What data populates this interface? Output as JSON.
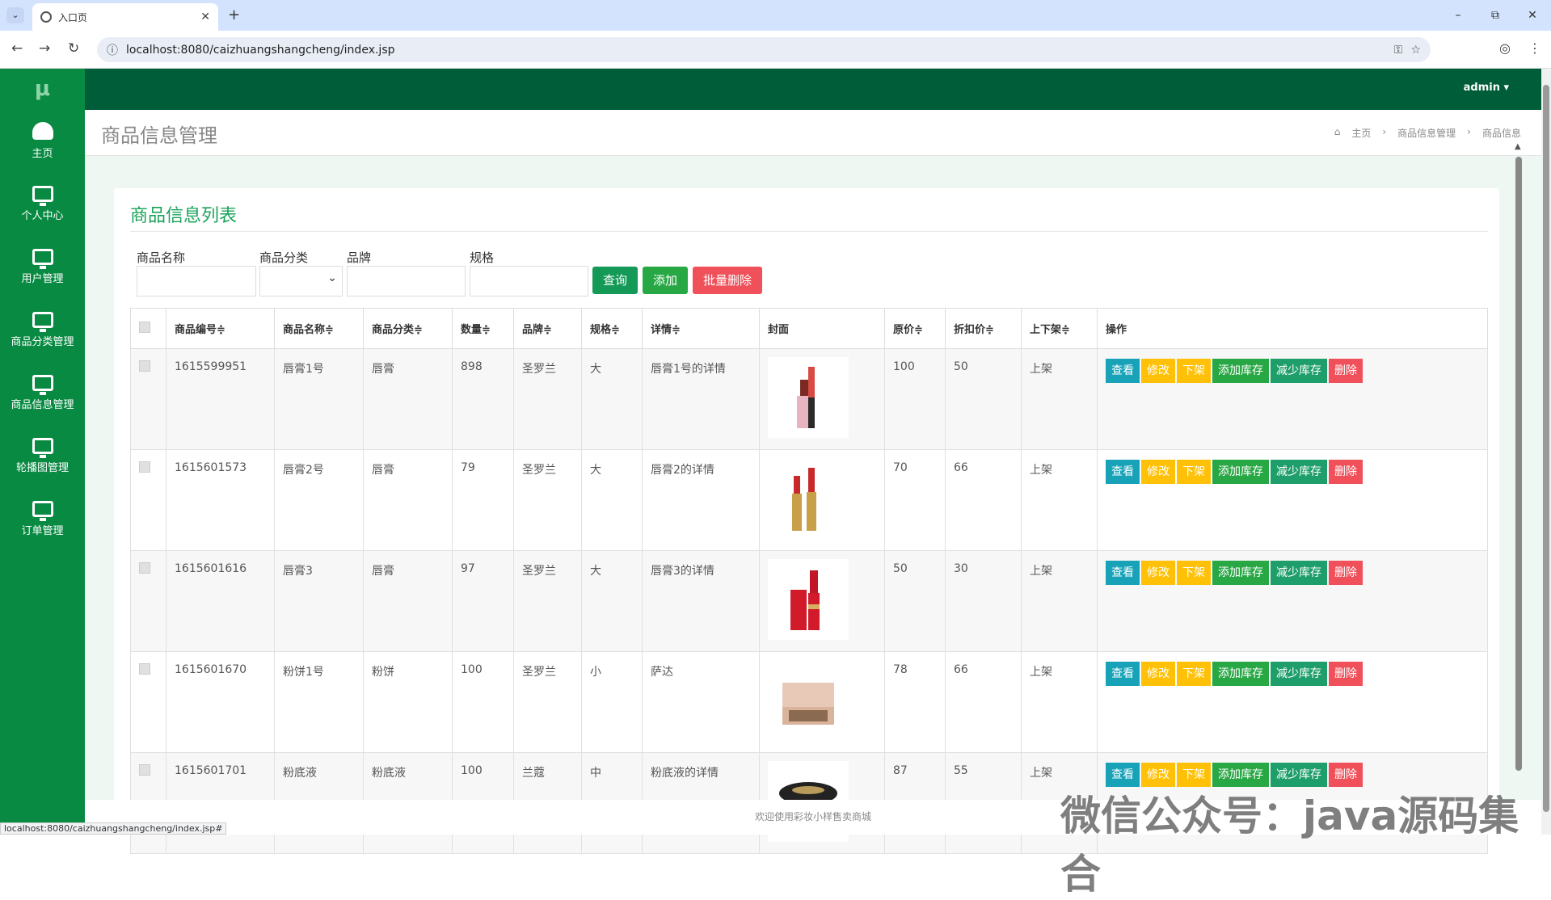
{
  "browser": {
    "tab_title": "入口页",
    "url": "localhost:8080/caizhuangshangcheng/index.jsp",
    "status_url": "localhost:8080/caizhuangshangcheng/index.jsp#",
    "new_tab": "+",
    "minimize": "–",
    "restore": "⧉",
    "close": "✕"
  },
  "sidebar": {
    "logo": "μ",
    "items": [
      {
        "label": "主页",
        "icon": "dashboard-icon"
      },
      {
        "label": "个人中心",
        "icon": "monitor-icon"
      },
      {
        "label": "用户管理",
        "icon": "monitor-icon"
      },
      {
        "label": "商品分类管理",
        "icon": "monitor-icon"
      },
      {
        "label": "商品信息管理",
        "icon": "monitor-icon"
      },
      {
        "label": "轮播图管理",
        "icon": "monitor-icon"
      },
      {
        "label": "订单管理",
        "icon": "monitor-icon"
      }
    ]
  },
  "topbar": {
    "user": "admin ▾"
  },
  "header": {
    "title": "商品信息管理",
    "breadcrumb": [
      "主页",
      "›",
      "商品信息管理",
      "›",
      "商品信息"
    ]
  },
  "panel": {
    "title": "商品信息列表",
    "filters": {
      "name": "商品名称",
      "category": "商品分类",
      "brand": "品牌",
      "spec": "规格"
    },
    "buttons": {
      "query": "查询",
      "add": "添加",
      "batch_delete": "批量删除"
    }
  },
  "table": {
    "headers": [
      "商品编号≑",
      "商品名称≑",
      "商品分类≑",
      "数量≑",
      "品牌≑",
      "规格≑",
      "详情≑",
      "封面",
      "原价≑",
      "折扣价≑",
      "上下架≑",
      "操作"
    ],
    "rows": [
      {
        "id": "1615599951",
        "name": "唇膏1号",
        "category": "唇膏",
        "qty": "898",
        "brand": "圣罗兰",
        "spec": "大",
        "detail": "唇膏1号的详情",
        "price": "100",
        "discount": "50",
        "status": "上架"
      },
      {
        "id": "1615601573",
        "name": "唇膏2号",
        "category": "唇膏",
        "qty": "79",
        "brand": "圣罗兰",
        "spec": "大",
        "detail": "唇膏2的详情",
        "price": "70",
        "discount": "66",
        "status": "上架"
      },
      {
        "id": "1615601616",
        "name": "唇膏3",
        "category": "唇膏",
        "qty": "97",
        "brand": "圣罗兰",
        "spec": "大",
        "detail": "唇膏3的详情",
        "price": "50",
        "discount": "30",
        "status": "上架"
      },
      {
        "id": "1615601670",
        "name": "粉饼1号",
        "category": "粉饼",
        "qty": "100",
        "brand": "圣罗兰",
        "spec": "小",
        "detail": "萨达",
        "price": "78",
        "discount": "66",
        "status": "上架"
      },
      {
        "id": "1615601701",
        "name": "粉底液",
        "category": "粉底液",
        "qty": "100",
        "brand": "兰蔻",
        "spec": "中",
        "detail": "粉底液的详情",
        "price": "87",
        "discount": "55",
        "status": "上架"
      }
    ],
    "ops": {
      "view": "查看",
      "edit": "修改",
      "off": "下架",
      "add_stock": "添加库存",
      "reduce_stock": "减少库存",
      "delete": "删除"
    }
  },
  "footer": {
    "text": "欢迎使用彩妆小样售卖商城"
  },
  "watermark": "微信公众号：java源码集合",
  "colors": {
    "sidebar": "#098a42",
    "topbar": "#005d39",
    "view": "#17a2b8",
    "edit": "#ffc107",
    "off": "#ffc107",
    "add_stock": "#28a745",
    "reduce_stock": "#1e9e6a",
    "delete": "#f0505a"
  }
}
